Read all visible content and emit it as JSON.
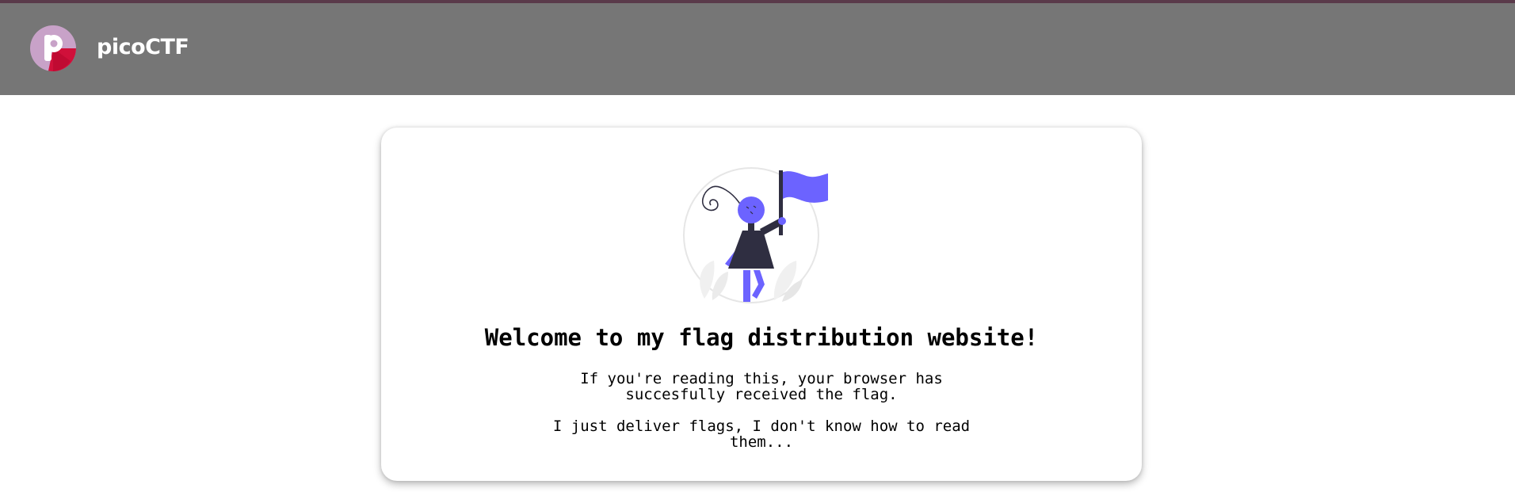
{
  "header": {
    "brand": "picoCTF",
    "logo_icon": "picoctf-logo-icon",
    "background": "#767676",
    "accent_line": "#5a3a4a"
  },
  "card": {
    "illustration_icon": "woman-holding-flag-illustration",
    "title": "Welcome to my flag distribution website!",
    "para1": {
      "line1": "If you're reading this, your browser has",
      "line2": "succesfully received the flag."
    },
    "para2": {
      "line1": "I just deliver flags, I don't know how to read",
      "line2": "them..."
    }
  },
  "colors": {
    "logo_purple": "#c8a2c8",
    "logo_red": "#d0103a",
    "flag_purple": "#6c63ff",
    "dark_figure": "#2f2e41"
  }
}
